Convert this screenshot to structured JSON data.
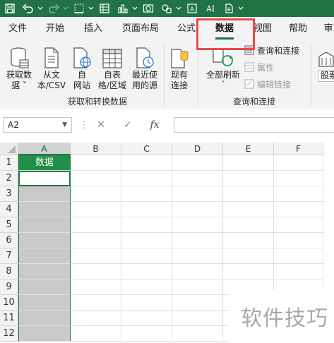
{
  "tabs": [
    "文件",
    "开始",
    "插入",
    "页面布局",
    "公式",
    "数据",
    "视图",
    "帮助",
    "审"
  ],
  "active_tab": "数据",
  "ribbon": {
    "get_transform": {
      "buttons": [
        {
          "label": "获取数\n据 ˅",
          "icon": "database-icon"
        },
        {
          "label": "从文\n本/CSV",
          "icon": "text-file-icon"
        },
        {
          "label": "自\n网站",
          "icon": "web-icon"
        },
        {
          "label": "自表\n格/区域",
          "icon": "table-icon"
        },
        {
          "label": "最近使\n用的源",
          "icon": "recent-sources-icon"
        },
        {
          "label": "现有\n连接",
          "icon": "existing-connections-icon"
        }
      ],
      "group_label": "获取和转换数据"
    },
    "queries": {
      "refresh_label": "全部刷新",
      "refresh_caret": "˅",
      "commands": [
        "查询和连接",
        "属性",
        "编辑链接"
      ],
      "group_label": "查询和连接"
    },
    "partial_button": "股票"
  },
  "formula_bar": {
    "name_box": "A2",
    "cancel": "✕",
    "enter": "✓",
    "fx": "fx",
    "formula": ""
  },
  "grid": {
    "columns": [
      "A",
      "B",
      "C",
      "D",
      "E",
      "F"
    ],
    "rows": [
      "1",
      "2",
      "3",
      "4",
      "5",
      "6",
      "7",
      "8",
      "9",
      "10",
      "11",
      "12"
    ],
    "a1_value": "数据"
  },
  "watermark": "软件技巧",
  "colors": {
    "accent": "#217346",
    "header_fill": "#218f4a",
    "highlight": "#e34b4b"
  }
}
